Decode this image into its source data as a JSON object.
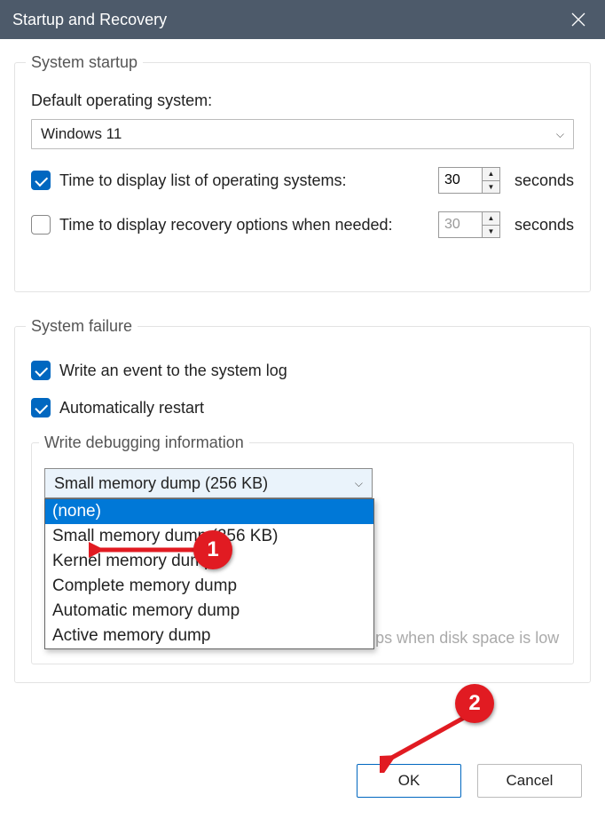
{
  "title": "Startup and Recovery",
  "startup": {
    "legend": "System startup",
    "default_os_label": "Default operating system:",
    "default_os_value": "Windows 11",
    "time_list": {
      "checked": true,
      "label": "Time to display list of operating systems:",
      "value": "30",
      "unit": "seconds"
    },
    "time_recovery": {
      "checked": false,
      "label": "Time to display recovery options when needed:",
      "value": "30",
      "unit": "seconds"
    }
  },
  "failure": {
    "legend": "System failure",
    "write_event": {
      "checked": true,
      "label": "Write an event to the system log"
    },
    "auto_restart": {
      "checked": true,
      "label": "Automatically restart"
    },
    "debug": {
      "legend": "Write debugging information",
      "selected": "Small memory dump (256 KB)",
      "options": [
        "(none)",
        "Small memory dump (256 KB)",
        "Kernel memory dump",
        "Complete memory dump",
        "Automatic memory dump",
        "Active memory dump"
      ],
      "highlighted_index": 0,
      "disable_auto_delete": {
        "checked": false,
        "label": "Disable automatic deletion of memory dumps when disk space is low"
      }
    }
  },
  "buttons": {
    "ok": "OK",
    "cancel": "Cancel"
  },
  "badges": {
    "1": "1",
    "2": "2"
  }
}
